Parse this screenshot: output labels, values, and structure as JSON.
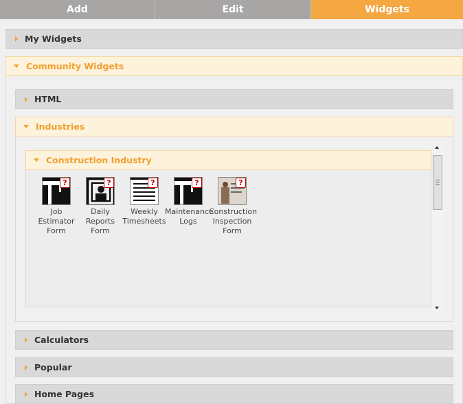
{
  "tabs": [
    {
      "label": "Add"
    },
    {
      "label": "Edit"
    },
    {
      "label": "Widgets"
    }
  ],
  "sections": {
    "my_widgets": "My Widgets",
    "community_widgets": "Community Widgets",
    "html": "HTML",
    "industries": "Industries",
    "construction_industry": "Construction Industry",
    "calculators": "Calculators",
    "popular": "Popular",
    "home_pages": "Home Pages"
  },
  "widgets": [
    {
      "label": "Job Estimator Form",
      "icon": "crane-icon"
    },
    {
      "label": "Daily Reports Form",
      "icon": "person-frame-icon"
    },
    {
      "label": "Weekly Timesheets",
      "icon": "document-lines-icon"
    },
    {
      "label": "Maintenance Logs",
      "icon": "crane-icon"
    },
    {
      "label": "Construction Inspection Form",
      "icon": "inspection-photo-icon"
    }
  ],
  "help_glyph": "?",
  "colors": {
    "accent": "#f5a742",
    "tab_inactive": "#a8a6a4",
    "open_header_bg": "#fdf2dc",
    "closed_header_bg": "#d9d9d9"
  }
}
